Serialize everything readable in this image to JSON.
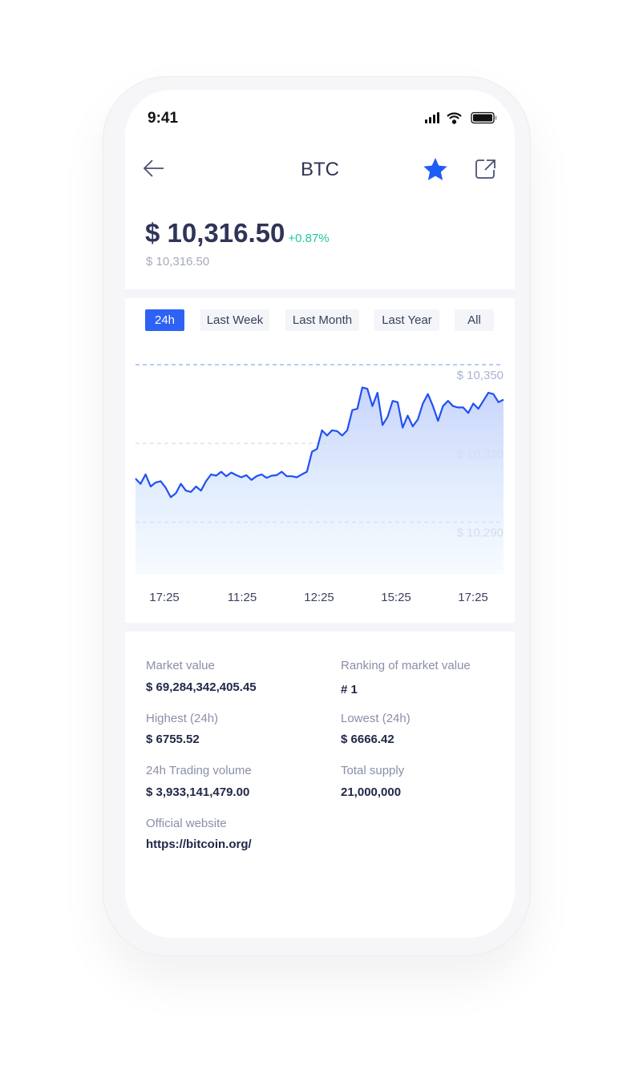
{
  "status_bar": {
    "time": "9:41",
    "icons": [
      "signal-icon",
      "wifi-icon",
      "battery-icon"
    ]
  },
  "header": {
    "title": "BTC",
    "back_icon": "arrow-left-icon",
    "favorite_icon": "star-icon",
    "share_icon": "external-link-icon",
    "accent": "#1e5cf7"
  },
  "price": {
    "value": "$ 10,316.50",
    "change": "+0.87%",
    "secondary": "$ 10,316.50",
    "change_color": "#1ec9a0"
  },
  "tabs": [
    {
      "label": "24h",
      "active": true
    },
    {
      "label": "Last Week"
    },
    {
      "label": "Last Month"
    },
    {
      "label": "Last Year"
    },
    {
      "label": "All"
    }
  ],
  "chart_data": {
    "type": "area",
    "x_tick_labels": [
      "17:25",
      "11:25",
      "12:25",
      "15:25",
      "17:25"
    ],
    "y_tick_labels": [
      "$ 10,350",
      "$ 10,320",
      "$ 10,290"
    ],
    "y_ticks": [
      10350,
      10320,
      10290
    ],
    "ylim": [
      10270,
      10350
    ],
    "grid": true,
    "line_color": "#2050f5",
    "values": [
      10306.6,
      10304.6,
      10308.2,
      10303.6,
      10305.1,
      10305.6,
      10303.1,
      10299.5,
      10301.0,
      10304.6,
      10302.0,
      10301.5,
      10303.6,
      10302.0,
      10305.6,
      10308.2,
      10307.7,
      10309.2,
      10307.5,
      10308.9,
      10307.9,
      10307.1,
      10307.9,
      10306.1,
      10307.5,
      10308.2,
      10306.9,
      10307.7,
      10307.9,
      10309.2,
      10307.5,
      10307.5,
      10307.1,
      10308.2,
      10309.2,
      10316.8,
      10317.9,
      10325.0,
      10323.0,
      10325.0,
      10324.7,
      10323.0,
      10325.0,
      10332.7,
      10333.2,
      10341.3,
      10340.8,
      10334.2,
      10339.3,
      10327.0,
      10330.1,
      10336.2,
      10335.7,
      10326.0,
      10330.6,
      10326.5,
      10329.1,
      10335.2,
      10338.8,
      10334.2,
      10328.6,
      10334.2,
      10336.2,
      10334.2,
      10333.7,
      10333.7,
      10331.6,
      10335.2,
      10333.2,
      10336.2,
      10339.3,
      10338.8,
      10335.7,
      10336.7
    ]
  },
  "stats": [
    {
      "label": "Market value",
      "value": "$ 69,284,342,405.45"
    },
    {
      "label": "Ranking of market value",
      "value": "# 1"
    },
    {
      "label": "Highest (24h)",
      "value": "$ 6755.52"
    },
    {
      "label": "Lowest (24h)",
      "value": "$ 6666.42"
    },
    {
      "label": "24h Trading volume",
      "value": "$ 3,933,141,479.00"
    },
    {
      "label": "Total supply",
      "value": "21,000,000"
    },
    {
      "label": "Official website",
      "value": "https://bitcoin.org/"
    }
  ]
}
